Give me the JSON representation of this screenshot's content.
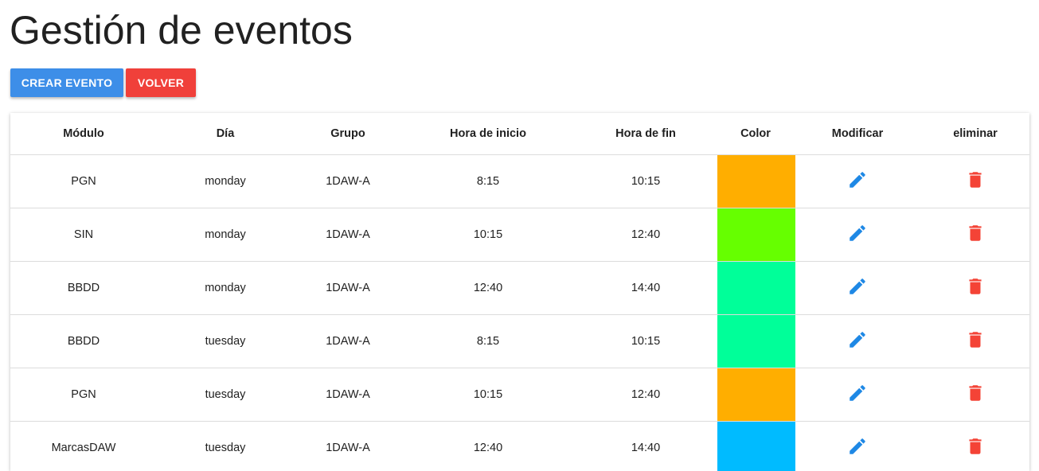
{
  "page": {
    "title": "Gestión de eventos"
  },
  "actions": {
    "create_label": "CREAR EVENTO",
    "back_label": "VOLVER"
  },
  "table": {
    "headers": [
      "Módulo",
      "Día",
      "Grupo",
      "Hora de inicio",
      "Hora de fin",
      "Color",
      "Modificar",
      "eliminar"
    ],
    "rows": [
      {
        "modulo": "PGN",
        "dia": "monday",
        "grupo": "1DAW-A",
        "inicio": "8:15",
        "fin": "10:15",
        "color": "#ffae00"
      },
      {
        "modulo": "SIN",
        "dia": "monday",
        "grupo": "1DAW-A",
        "inicio": "10:15",
        "fin": "12:40",
        "color": "#66ff00"
      },
      {
        "modulo": "BBDD",
        "dia": "monday",
        "grupo": "1DAW-A",
        "inicio": "12:40",
        "fin": "14:40",
        "color": "#00ff99"
      },
      {
        "modulo": "BBDD",
        "dia": "tuesday",
        "grupo": "1DAW-A",
        "inicio": "8:15",
        "fin": "10:15",
        "color": "#00ff99"
      },
      {
        "modulo": "PGN",
        "dia": "tuesday",
        "grupo": "1DAW-A",
        "inicio": "10:15",
        "fin": "12:40",
        "color": "#ffae00"
      },
      {
        "modulo": "MarcasDAW",
        "dia": "tuesday",
        "grupo": "1DAW-A",
        "inicio": "12:40",
        "fin": "14:40",
        "color": "#00bbff"
      }
    ],
    "edit_icon": "pencil-icon",
    "delete_icon": "trash-icon"
  },
  "colors": {
    "primary": "#3d8ee8",
    "danger": "#f0403a",
    "edit_icon": "#1e88e5",
    "delete_icon": "#f44336"
  }
}
